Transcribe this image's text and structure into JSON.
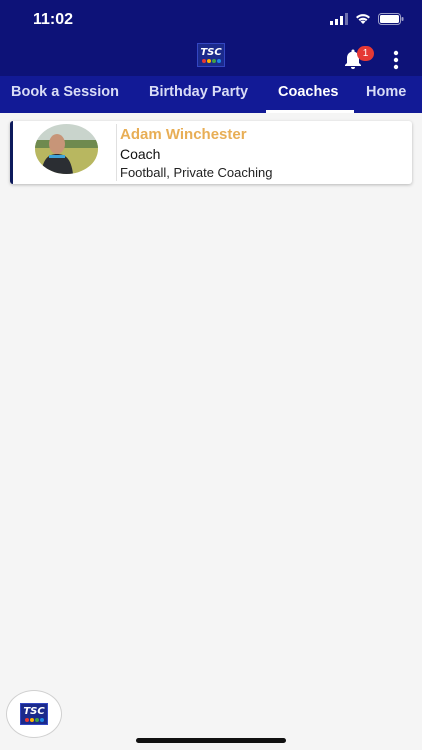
{
  "status_bar": {
    "time": "11:02"
  },
  "app_bar": {
    "logo_text": "TSC",
    "notification_count": "1",
    "icons": [
      "bell-icon",
      "more-vert-icon"
    ]
  },
  "tabs": [
    {
      "label": "Book a Session",
      "active": false
    },
    {
      "label": "Birthday Party",
      "active": false
    },
    {
      "label": "Coaches",
      "active": true
    },
    {
      "label": "Home",
      "active": false
    }
  ],
  "coaches": [
    {
      "name": "Adam Winchester",
      "role": "Coach",
      "specialties": "Football, Private Coaching"
    }
  ],
  "fab": {
    "logo_text": "TSC"
  },
  "colors": {
    "header": "#0d1278",
    "tabs": "#121a96",
    "coach_name": "#e8ae55",
    "badge": "#e53935"
  }
}
